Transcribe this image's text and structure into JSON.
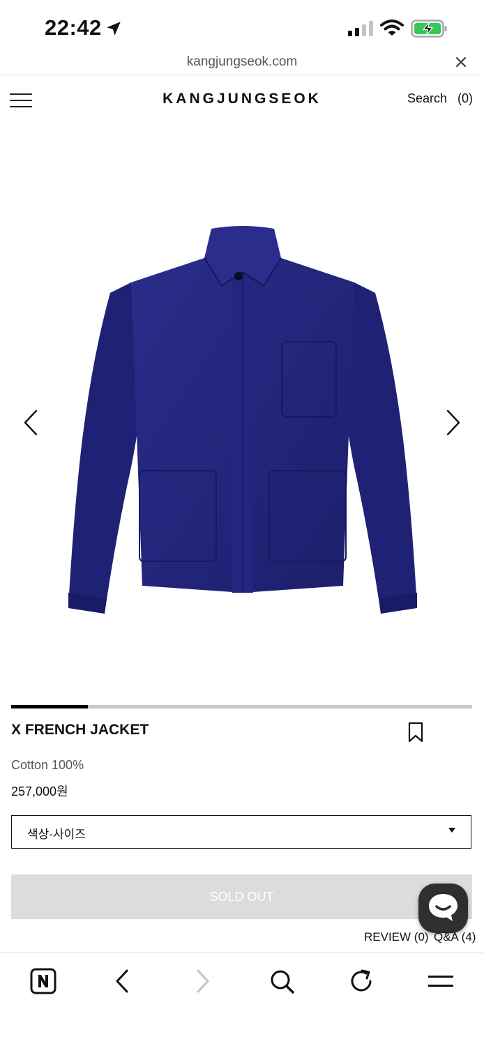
{
  "status_bar": {
    "time": "22:42",
    "icons": [
      "location-arrow-icon",
      "cellular-signal-icon",
      "wifi-icon",
      "battery-charging-icon"
    ]
  },
  "browser": {
    "url": "kangjungseok.com",
    "close_icon": "close-icon",
    "toolbar_icons": [
      "naver-home-icon",
      "back-icon",
      "forward-icon",
      "search-icon",
      "reload-icon",
      "menu-icon"
    ]
  },
  "header": {
    "brand": "KANGJUNGSEOK",
    "search_label": "Search",
    "cart_count": "(0)",
    "menu_icon": "hamburger-menu-icon"
  },
  "gallery": {
    "image_description_icon": "navy-jacket-image",
    "prev_icon": "chevron-left-icon",
    "next_icon": "chevron-right-icon",
    "progress": 0.167
  },
  "product": {
    "name": "X FRENCH JACKET",
    "material": "Cotton 100%",
    "price": "257,000원",
    "bookmark_icon": "bookmark-icon",
    "option_placeholder": "색상-사이즈",
    "soldout_label": "SOLD OUT"
  },
  "links": {
    "review": "REVIEW (0)",
    "qa": "Q&A (4)"
  },
  "colors": {
    "jacket": "#20237a",
    "soldout_bg": "#dcdcdc",
    "chat_bg": "#2f2f2f"
  }
}
